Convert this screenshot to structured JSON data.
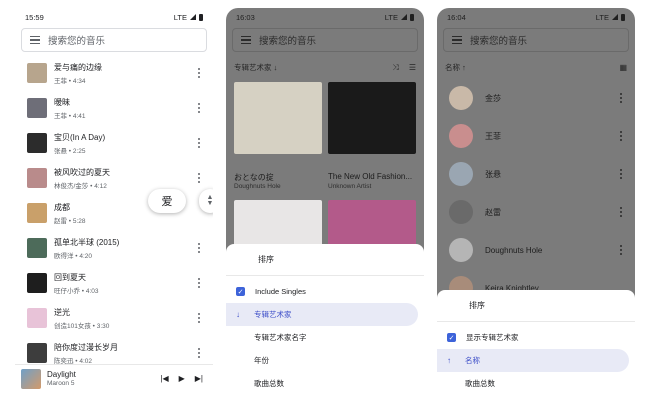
{
  "phone1": {
    "status_time": "15:59",
    "status_right": "LTE",
    "search_placeholder": "搜索您的音乐",
    "songs": [
      {
        "title": "爱与痛的边缘",
        "sub": "王菲 • 4:34",
        "color": "#b7a58d"
      },
      {
        "title": "暧昧",
        "sub": "王菲 • 4:41",
        "color": "#6e6e78"
      },
      {
        "title": "宝贝(In A Day)",
        "sub": "张悬 • 2:25",
        "color": "#2c2c2c"
      },
      {
        "title": "被风吹过的夏天",
        "sub": "林俊杰/金莎 • 4:12",
        "color": "#b98b8b"
      },
      {
        "title": "成都",
        "sub": "赵雷 • 5:28",
        "color": "#c9a06a"
      },
      {
        "title": "孤单北半球 (2015)",
        "sub": "欧得洋 • 4:20",
        "color": "#4d6b5a"
      },
      {
        "title": "回到夏天",
        "sub": "旺仔小乔 • 4:03",
        "color": "#1e1e1e"
      },
      {
        "title": "逆光",
        "sub": "创造101女孩 • 3:30",
        "color": "#e8c3d8"
      },
      {
        "title": "陪你度过漫长岁月",
        "sub": "陈奕迅 • 4:02",
        "color": "#3d3d3d"
      }
    ],
    "index_bubble": "爱",
    "player": {
      "title": "Daylight",
      "artist": "Maroon 5",
      "prev": "|◀",
      "play": "▶",
      "next": "▶|"
    }
  },
  "phone2": {
    "status_time": "16:03",
    "status_right": "LTE",
    "search_placeholder": "搜索您的音乐",
    "sort_label": "专辑艺术家 ↓",
    "albums": [
      {
        "title": "おとなの掟",
        "artist": "Doughnuts Hole",
        "color": "#d6d1c3"
      },
      {
        "title": "The New Old Fashion...",
        "artist": "Unknown Artist",
        "color": "#1a1a1a"
      },
      {
        "title": "",
        "artist": "",
        "color": "#e8e6e6"
      },
      {
        "title": "",
        "artist": "",
        "color": "#b35a8a"
      }
    ],
    "sheet": {
      "title": "排序",
      "include_singles": "Include Singles",
      "options": [
        "专辑艺术家",
        "专辑艺术家名字",
        "年份",
        "歌曲总数"
      ]
    }
  },
  "phone3": {
    "status_time": "16:04",
    "status_right": "LTE",
    "search_placeholder": "搜索您的音乐",
    "sort_label": "名称 ↑",
    "artists": [
      {
        "name": "金莎",
        "color": "#c9b9a8"
      },
      {
        "name": "王菲",
        "color": "#c98e8e"
      },
      {
        "name": "张悬",
        "color": "#9aa6b2"
      },
      {
        "name": "赵雷",
        "color": "#6a6a6a"
      },
      {
        "name": "Doughnuts Hole",
        "color": "#b5b5b5"
      },
      {
        "name": "Keira Knightley",
        "color": "#a88c7a"
      }
    ],
    "sheet": {
      "title": "排序",
      "show_album_artist": "显示专辑艺术家",
      "options": [
        "名称",
        "歌曲总数"
      ]
    }
  }
}
